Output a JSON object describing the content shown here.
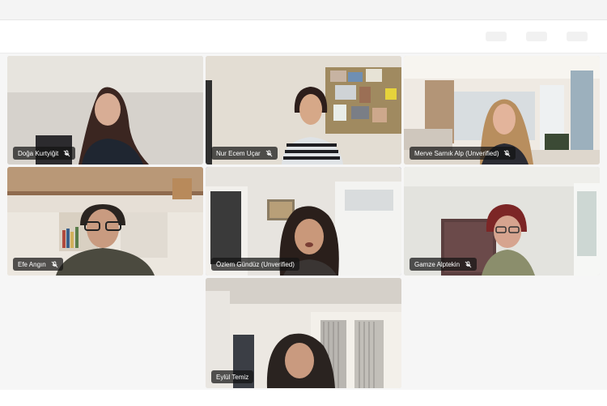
{
  "participants": [
    {
      "name": "Doğa Kurtyiğit",
      "muted": true
    },
    {
      "name": "Nur Ecem Uçar",
      "muted": true
    },
    {
      "name": "Merve Sarnık Alp (Unverified)",
      "muted": true
    },
    {
      "name": "Efe Angın",
      "muted": true
    },
    {
      "name": "Özlem Gündüz (Unverified)",
      "muted": false,
      "active_speaker": true
    },
    {
      "name": "Gamze Alptekin",
      "muted": true
    },
    {
      "name": "Eylül Temiz",
      "muted": false
    }
  ],
  "colors": {
    "active_speaker_border": "#6e68c8",
    "name_label_bg": "#141414"
  },
  "icons": {
    "muted": "mic-off-icon"
  }
}
